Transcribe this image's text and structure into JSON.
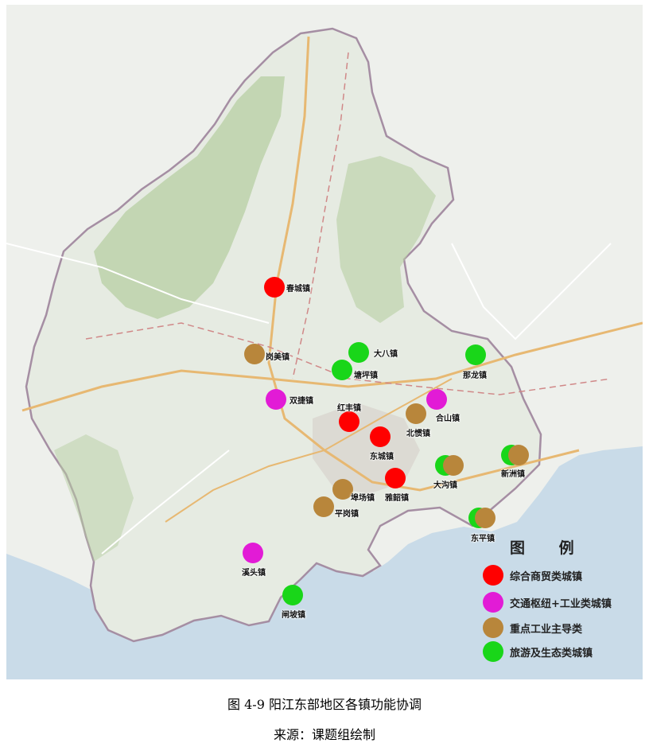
{
  "map": {
    "colors": {
      "land_outside": "#eef0ec",
      "region_fill": "#e6ebe2",
      "terrain_green": "#b7cfa3",
      "sea": "#c9dbe8",
      "boundary": "#a58ea3",
      "urban": "#d9d6cf",
      "road_major": "#e7b872",
      "road_minor": "#ffffff",
      "railway": "#d08888"
    },
    "towns": [
      {
        "name": "春城镇",
        "category": "commercial"
      },
      {
        "name": "岗美镇",
        "category": "industrial"
      },
      {
        "name": "大八镇",
        "category": "tourism"
      },
      {
        "name": "塘坪镇",
        "category": "tourism"
      },
      {
        "name": "那龙镇",
        "category": "tourism"
      },
      {
        "name": "双捷镇",
        "category": "transport"
      },
      {
        "name": "合山镇",
        "category": "transport"
      },
      {
        "name": "红丰镇",
        "category": "commercial"
      },
      {
        "name": "北惯镇",
        "category": "industrial"
      },
      {
        "name": "东城镇",
        "category": "commercial"
      },
      {
        "name": "大沟镇",
        "category": "tourism+industrial"
      },
      {
        "name": "新洲镇",
        "category": "tourism+industrial"
      },
      {
        "name": "雅韶镇",
        "category": "commercial"
      },
      {
        "name": "埠场镇",
        "category": "industrial"
      },
      {
        "name": "平岗镇",
        "category": "industrial"
      },
      {
        "name": "东平镇",
        "category": "tourism+industrial"
      },
      {
        "name": "溪头镇",
        "category": "transport"
      },
      {
        "name": "闸坡镇",
        "category": "tourism"
      }
    ]
  },
  "legend": {
    "title": "图 例",
    "items": [
      {
        "label": "综合商贸类城镇",
        "color": "#ff0000"
      },
      {
        "label": "交通枢纽+工业类城镇",
        "color": "#e21bd6"
      },
      {
        "label": "重点工业主导类",
        "color": "#b8863b"
      },
      {
        "label": "旅游及生态类城镇",
        "color": "#19d619"
      }
    ]
  },
  "caption": "图 4-9 阳江东部地区各镇功能协调",
  "source": "来源：课题组绘制"
}
